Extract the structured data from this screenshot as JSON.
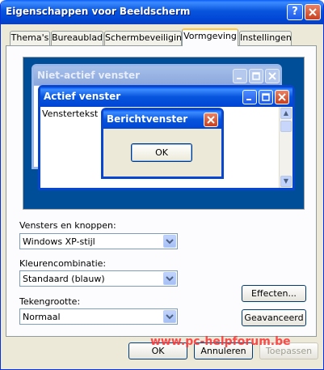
{
  "window": {
    "title": "Eigenschappen voor Beeldscherm"
  },
  "tabs": [
    "Thema's",
    "Bureaublad",
    "Schermbeveiliging",
    "Vormgeving",
    "Instellingen"
  ],
  "active_tab": "Vormgeving",
  "preview": {
    "inactive_title": "Niet-actief venster",
    "active_title": "Actief venster",
    "window_text": "Venstertekst",
    "message_title": "Berichtvenster",
    "message_ok": "OK"
  },
  "settings": {
    "windows_label": "Vensters en knoppen:",
    "windows_value": "Windows XP-stijl",
    "color_label": "Kleurencombinatie:",
    "color_value": "Standaard (blauw)",
    "font_label": "Tekengrootte:",
    "font_value": "Normaal"
  },
  "buttons": {
    "effects": "Effecten...",
    "advanced": "Geavanceerd",
    "ok": "OK",
    "cancel": "Annuleren",
    "apply": "Toepassen"
  },
  "watermark": "www.pc-helpforum.be",
  "colors": {
    "titlebar": "#0054e3",
    "desktop": "#004e98",
    "dialog_bg": "#ece9d8",
    "watermark": "#ff3030"
  }
}
